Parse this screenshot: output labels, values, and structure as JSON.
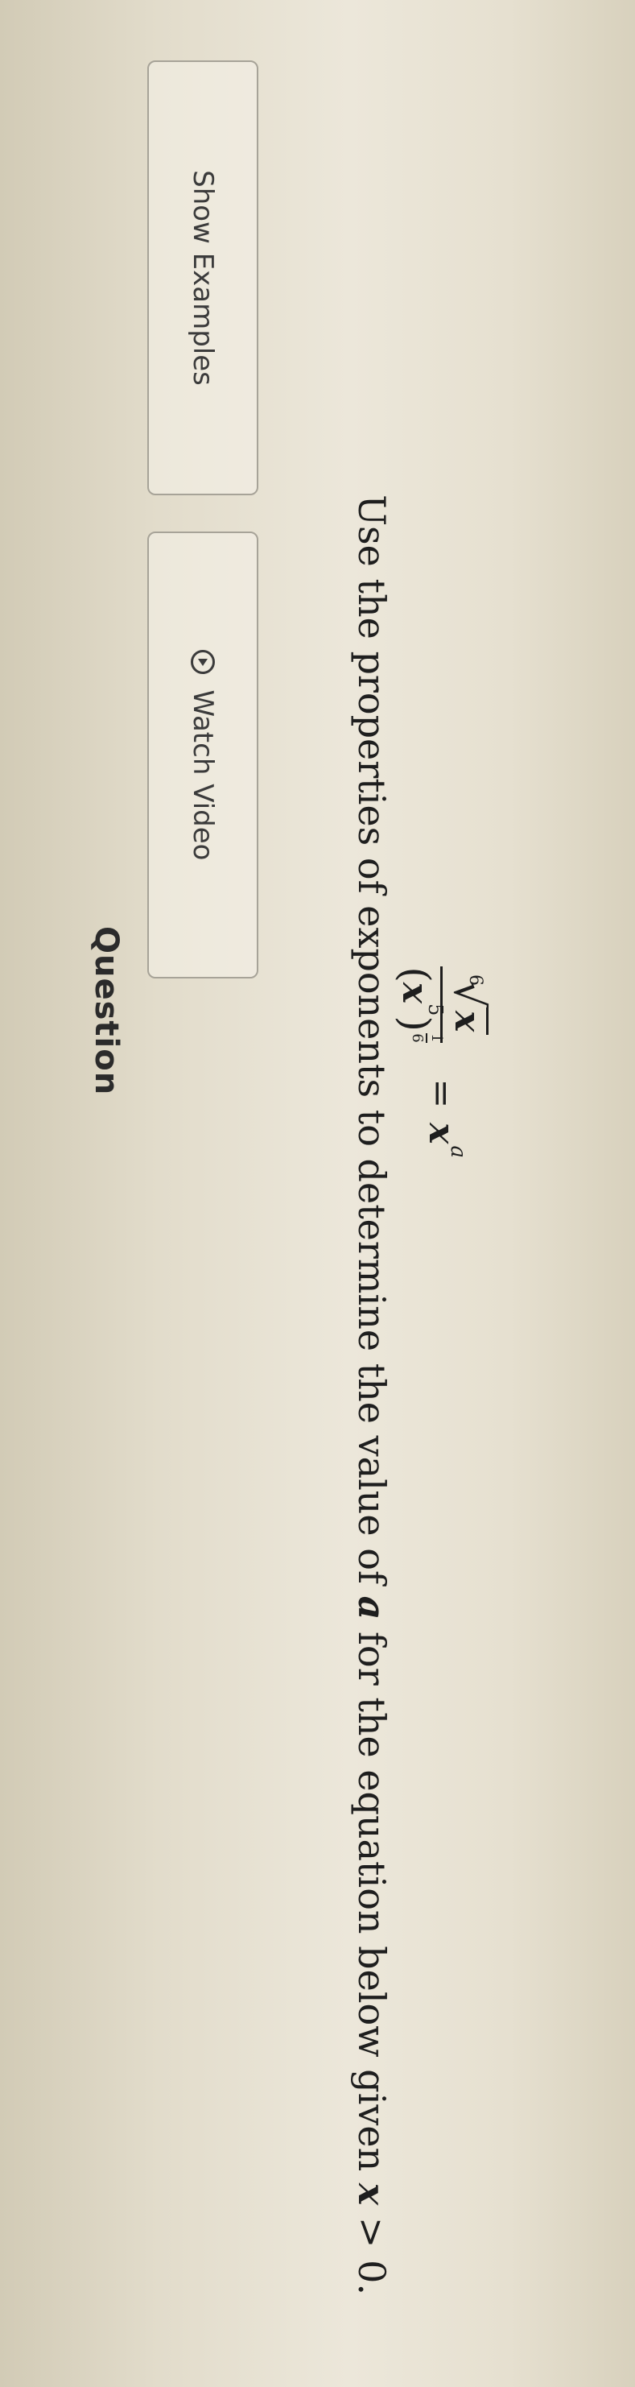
{
  "header": {
    "question_label": "Question"
  },
  "buttons": {
    "watch_video_label": "Watch Video",
    "show_examples_label": "Show Examples"
  },
  "problem": {
    "text_before": "Use the properties of exponents to determine the value of ",
    "variable_a": "a",
    "text_middle": " for the equation below given ",
    "condition_var": "x",
    "condition_rest": " > 0."
  },
  "equation": {
    "root_index": "6",
    "radicand": "x",
    "denominator_base": "x",
    "denominator_inner_exponent": "5",
    "outer_exponent_numerator": "1",
    "outer_exponent_denominator": "6",
    "equals": "=",
    "rhs_base": "x",
    "rhs_exponent": "a"
  },
  "icons": {
    "watch_video": "play-circle-icon"
  }
}
